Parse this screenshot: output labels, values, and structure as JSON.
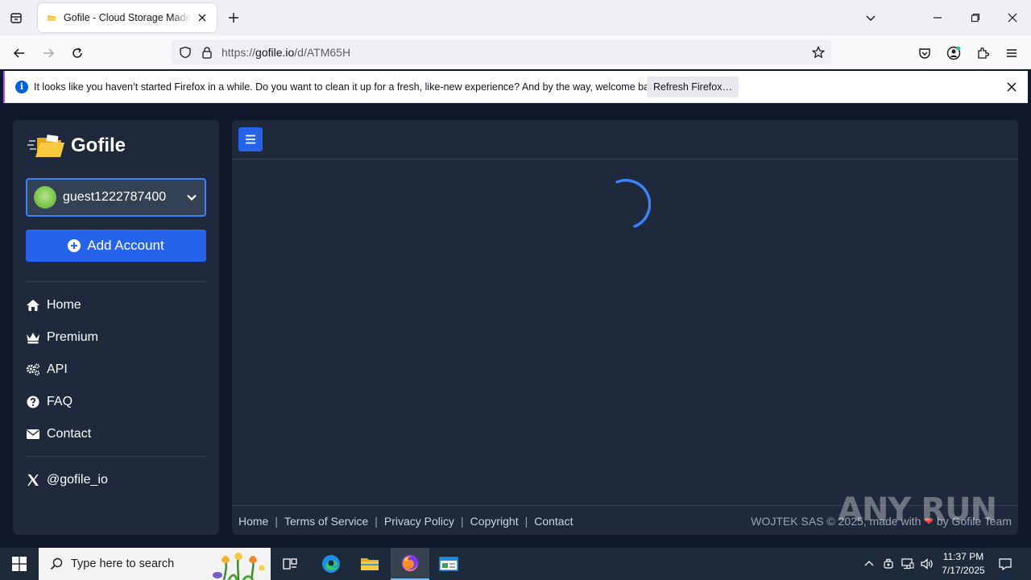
{
  "browser": {
    "tab_title": "Gofile - Cloud Storage Made Simple",
    "url_prefix": "https://",
    "url_host": "gofile.io",
    "url_path": "/d/ATM65H",
    "notification": {
      "message": "It looks like you haven’t started Firefox in a while. Do you want to clean it up for a fresh, like-new experience? And by the way, welcome back!",
      "refresh_label": "Refresh Firefox…"
    }
  },
  "sidebar": {
    "brand": "Gofile",
    "account_name": "guest1222787400",
    "add_account_label": "Add Account",
    "nav": [
      {
        "label": "Home",
        "icon": "home-icon"
      },
      {
        "label": "Premium",
        "icon": "crown-icon"
      },
      {
        "label": "API",
        "icon": "cogs-icon"
      },
      {
        "label": "FAQ",
        "icon": "question-icon"
      },
      {
        "label": "Contact",
        "icon": "envelope-icon"
      }
    ],
    "social_label": "@gofile_io"
  },
  "footer": {
    "links": [
      "Home",
      "Terms of Service",
      "Privacy Policy",
      "Copyright",
      "Contact"
    ],
    "copyright_left": "WOJTEK SAS © 2025, made with",
    "heart": "❤",
    "copyright_right": "by Gofile Team"
  },
  "watermark": "ANY RUN",
  "taskbar": {
    "search_placeholder": "Type here to search",
    "time": "11:37 PM",
    "date": "7/17/2025"
  },
  "colors": {
    "page_bg": "#0f172a",
    "panel_bg": "#1e293b",
    "accent": "#2563eb",
    "account_border": "#3b82f6"
  }
}
